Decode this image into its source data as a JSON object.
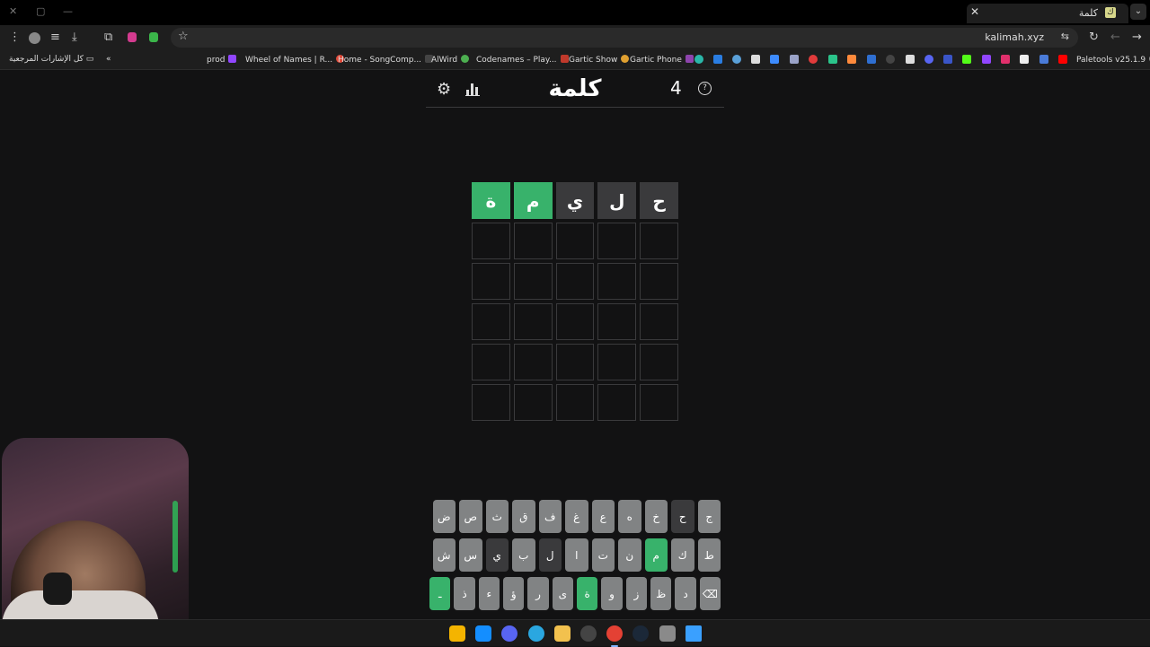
{
  "browser": {
    "tab_title": "كلمة",
    "tab_favicon": "ك",
    "url": "kalimah.xyz",
    "bookmarks_all_label": "كل الإشارات المرجعية",
    "bookmarks": [
      {
        "label": "prod",
        "color": "#9146ff"
      },
      {
        "label": "Wheel of Names | R...",
        "color": "#e04a3a"
      },
      {
        "label": "Home - SongComp...",
        "color": "#444444"
      },
      {
        "label": "AlWird",
        "color": "#4caf50"
      },
      {
        "label": "Codenames – Play...",
        "color": "#c0392b"
      },
      {
        "label": "Gartic Show",
        "color": "#e0a030"
      },
      {
        "label": "Gartic Phone",
        "color": "#8e44ad"
      },
      {
        "label": "Paletools v25.1.9",
        "color": "#888888"
      }
    ]
  },
  "game": {
    "title": "كلمة",
    "streak": "4",
    "timer_glyph": "?",
    "board": [
      [
        {
          "letter": "ح",
          "state": "absent"
        },
        {
          "letter": "ل",
          "state": "absent"
        },
        {
          "letter": "ي",
          "state": "absent"
        },
        {
          "letter": "م",
          "state": "correct"
        },
        {
          "letter": "ة",
          "state": "correct"
        }
      ],
      [
        {
          "letter": "",
          "state": "empty"
        },
        {
          "letter": "",
          "state": "empty"
        },
        {
          "letter": "",
          "state": "empty"
        },
        {
          "letter": "",
          "state": "empty"
        },
        {
          "letter": "",
          "state": "empty"
        }
      ],
      [
        {
          "letter": "",
          "state": "empty"
        },
        {
          "letter": "",
          "state": "empty"
        },
        {
          "letter": "",
          "state": "empty"
        },
        {
          "letter": "",
          "state": "empty"
        },
        {
          "letter": "",
          "state": "empty"
        }
      ],
      [
        {
          "letter": "",
          "state": "empty"
        },
        {
          "letter": "",
          "state": "empty"
        },
        {
          "letter": "",
          "state": "empty"
        },
        {
          "letter": "",
          "state": "empty"
        },
        {
          "letter": "",
          "state": "empty"
        }
      ],
      [
        {
          "letter": "",
          "state": "empty"
        },
        {
          "letter": "",
          "state": "empty"
        },
        {
          "letter": "",
          "state": "empty"
        },
        {
          "letter": "",
          "state": "empty"
        },
        {
          "letter": "",
          "state": "empty"
        }
      ],
      [
        {
          "letter": "",
          "state": "empty"
        },
        {
          "letter": "",
          "state": "empty"
        },
        {
          "letter": "",
          "state": "empty"
        },
        {
          "letter": "",
          "state": "empty"
        },
        {
          "letter": "",
          "state": "empty"
        }
      ]
    ],
    "keyboard": [
      [
        {
          "key": "ج",
          "state": ""
        },
        {
          "key": "ح",
          "state": "absent"
        },
        {
          "key": "خ",
          "state": ""
        },
        {
          "key": "ه",
          "state": ""
        },
        {
          "key": "ع",
          "state": ""
        },
        {
          "key": "غ",
          "state": ""
        },
        {
          "key": "ف",
          "state": ""
        },
        {
          "key": "ق",
          "state": ""
        },
        {
          "key": "ث",
          "state": ""
        },
        {
          "key": "ص",
          "state": ""
        },
        {
          "key": "ض",
          "state": ""
        }
      ],
      [
        {
          "key": "ط",
          "state": ""
        },
        {
          "key": "ك",
          "state": ""
        },
        {
          "key": "م",
          "state": "correct"
        },
        {
          "key": "ن",
          "state": ""
        },
        {
          "key": "ت",
          "state": ""
        },
        {
          "key": "ا",
          "state": ""
        },
        {
          "key": "ل",
          "state": "absent"
        },
        {
          "key": "ب",
          "state": ""
        },
        {
          "key": "ي",
          "state": "absent"
        },
        {
          "key": "س",
          "state": ""
        },
        {
          "key": "ش",
          "state": ""
        }
      ],
      [
        {
          "key": "⌫",
          "state": ""
        },
        {
          "key": "د",
          "state": ""
        },
        {
          "key": "ظ",
          "state": ""
        },
        {
          "key": "ز",
          "state": ""
        },
        {
          "key": "و",
          "state": ""
        },
        {
          "key": "ة",
          "state": "correct"
        },
        {
          "key": "ى",
          "state": ""
        },
        {
          "key": "ر",
          "state": ""
        },
        {
          "key": "ؤ",
          "state": ""
        },
        {
          "key": "ء",
          "state": ""
        },
        {
          "key": "ذ",
          "state": ""
        },
        {
          "key": "ـ",
          "state": "correct"
        }
      ]
    ]
  },
  "colors": {
    "correct": "#38b26b",
    "absent": "#3a3a3c",
    "key_default": "#818384",
    "background": "#121213"
  },
  "taskbar": {
    "apps": [
      {
        "name": "rockstar-icon",
        "color": "#f4b400"
      },
      {
        "name": "battle-net-icon",
        "color": "#148eff"
      },
      {
        "name": "discord-icon",
        "color": "#5865f2"
      },
      {
        "name": "edge-icon",
        "color": "#2aa7e0"
      },
      {
        "name": "folder-icon",
        "color": "#f2c14e"
      },
      {
        "name": "obs-icon",
        "color": "#444444"
      },
      {
        "name": "chrome-icon",
        "color": "#e44134"
      },
      {
        "name": "steam-icon",
        "color": "#1b2838"
      },
      {
        "name": "settings-icon",
        "color": "#8a8a8a"
      },
      {
        "name": "windows-start-icon",
        "color": "#3aa0ff"
      }
    ]
  }
}
